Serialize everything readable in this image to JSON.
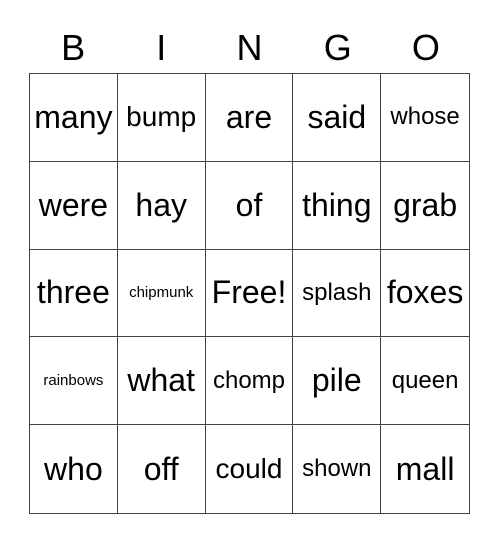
{
  "header": [
    "B",
    "I",
    "N",
    "G",
    "O"
  ],
  "cells": [
    {
      "text": "many",
      "size": "xl"
    },
    {
      "text": "bump",
      "size": "l"
    },
    {
      "text": "are",
      "size": "xl"
    },
    {
      "text": "said",
      "size": "xl"
    },
    {
      "text": "whose",
      "size": "m"
    },
    {
      "text": "were",
      "size": "xl"
    },
    {
      "text": "hay",
      "size": "xl"
    },
    {
      "text": "of",
      "size": "xl"
    },
    {
      "text": "thing",
      "size": "xl"
    },
    {
      "text": "grab",
      "size": "xl"
    },
    {
      "text": "three",
      "size": "xl"
    },
    {
      "text": "chipmunk",
      "size": "s"
    },
    {
      "text": "Free!",
      "size": "xl"
    },
    {
      "text": "splash",
      "size": "m"
    },
    {
      "text": "foxes",
      "size": "xl"
    },
    {
      "text": "rainbows",
      "size": "s"
    },
    {
      "text": "what",
      "size": "xl"
    },
    {
      "text": "chomp",
      "size": "m"
    },
    {
      "text": "pile",
      "size": "xl"
    },
    {
      "text": "queen",
      "size": "m"
    },
    {
      "text": "who",
      "size": "xl"
    },
    {
      "text": "off",
      "size": "xl"
    },
    {
      "text": "could",
      "size": "l"
    },
    {
      "text": "shown",
      "size": "m"
    },
    {
      "text": "mall",
      "size": "xl"
    }
  ]
}
